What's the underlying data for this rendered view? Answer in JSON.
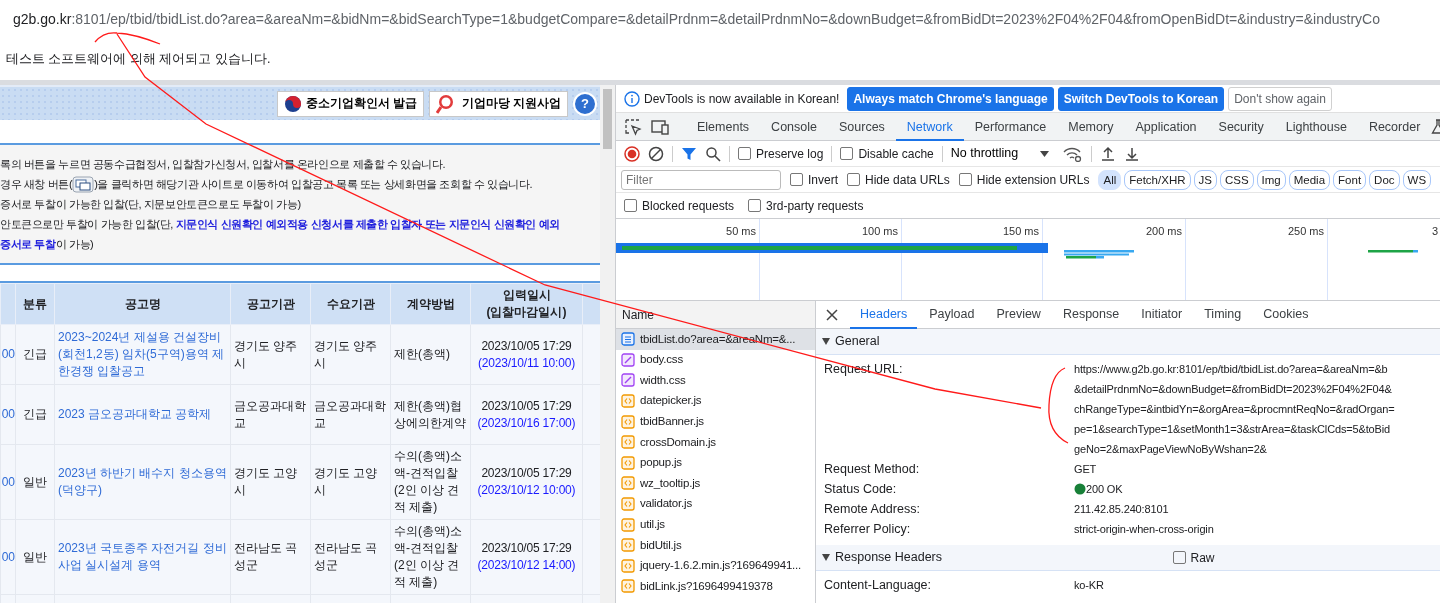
{
  "browser": {
    "url_host": "g2b.go.kr",
    "url_rest": ":8101/ep/tbid/tbidList.do?area=&areaNm=&bidNm=&bidSearchType=1&budgetCompare=&detailPrdnm=&detailPrdnmNo=&downBudget=&fromBidDt=2023%2F04%2F04&fromOpenBidDt=&industry=&industryCo",
    "infobar": "테스트 소프트웨어에 의해 제어되고 있습니다."
  },
  "page": {
    "banner_buttons": [
      {
        "label": "중소기업확인서 발급",
        "kind": "emblem"
      },
      {
        "label": "기업마당 지원사업",
        "kind": "bizinfo"
      }
    ],
    "help_label": "?",
    "notice": [
      {
        "text": "록의 버튼을 누르면 공동수급협정서, 입찰참가신청서, 입찰서를 온라인으로 제출할 수 있습니다."
      },
      {
        "text": "경우 새창 버튼(",
        "text_after": ")을 클릭하면 해당기관 사이트로 이동하여 입찰공고 목록 또는 상세화면을 조회할 수 있습니다."
      },
      {
        "text": "증서로 투찰이 가능한 입찰(단, 지문보안토큰으로도 투찰이 가능)"
      },
      {
        "text": "안토큰으로만 투찰이 가능한 입찰(단, **지문인식 신원확인 예외적용 신청서를 제출한 입찰자 또는 지문인식 신원확인 예외**"
      },
      {
        "text": "**증서로 투찰**이 가능)"
      }
    ],
    "table": {
      "columns": [
        "분류",
        "공고명",
        "공고기관",
        "수요기관",
        "계약방법",
        "입력일시\n(입찰마감일시)"
      ],
      "rows": [
        {
          "number": "00",
          "category": "긴급",
          "title": "2023~2024년 제설용 건설장비(회천1,2동) 임차(5구역)용역 제한경쟁 입찰공고",
          "agency": "경기도 양주시",
          "demand": "경기도 양주시",
          "method": "제한(총액)",
          "entered": "2023/10/05 17:29",
          "deadline": "(2023/10/11 10:00)"
        },
        {
          "number": "00",
          "category": "긴급",
          "title": "2023 금오공과대학교 공학제",
          "agency": "금오공과대학교",
          "demand": "금오공과대학교",
          "method": "제한(총액)협상에의한계약",
          "entered": "2023/10/05 17:29",
          "deadline": "(2023/10/16 17:00)"
        },
        {
          "number": "00",
          "category": "일반",
          "title": "2023년 하반기 배수지 청소용역(덕양구)",
          "agency": "경기도 고양시",
          "demand": "경기도 고양시",
          "method": "수의(총액)소액-견적입찰(2인 이상 견적 제출)",
          "entered": "2023/10/05 17:29",
          "deadline": "(2023/10/12 10:00)"
        },
        {
          "number": "00",
          "category": "일반",
          "title": "2023년 국토종주 자전거길 정비사업 실시설계 용역",
          "agency": "전라남도 곡성군",
          "demand": "전라남도 곡성군",
          "method": "수의(총액)소액-견적입찰(2인 이상 견적 제출)",
          "entered": "2023/10/05 17:29",
          "deadline": "(2023/10/12 14:00)"
        }
      ]
    }
  },
  "devtools": {
    "banner": {
      "message": "DevTools is now available in Korean!",
      "buttons": [
        {
          "label": "Always match Chrome's language",
          "kind": "primary"
        },
        {
          "label": "Switch DevTools to Korean",
          "kind": "primary"
        },
        {
          "label": "Don't show again",
          "kind": "plain"
        }
      ]
    },
    "tabs": [
      {
        "label": "Elements",
        "selected": false
      },
      {
        "label": "Console",
        "selected": false
      },
      {
        "label": "Sources",
        "selected": false
      },
      {
        "label": "Network",
        "selected": true
      },
      {
        "label": "Performance",
        "selected": false
      },
      {
        "label": "Memory",
        "selected": false
      },
      {
        "label": "Application",
        "selected": false
      },
      {
        "label": "Security",
        "selected": false
      },
      {
        "label": "Lighthouse",
        "selected": false
      },
      {
        "label": "Recorder",
        "selected": false
      }
    ],
    "toolbar": {
      "checkboxes": [
        {
          "label": "Preserve log",
          "checked": false
        },
        {
          "label": "Disable cache",
          "checked": false
        }
      ],
      "throttling": "No throttling"
    },
    "filter": {
      "placeholder": "Filter",
      "checkboxes": [
        {
          "label": "Invert",
          "checked": false
        },
        {
          "label": "Hide data URLs",
          "checked": false
        },
        {
          "label": "Hide extension URLs",
          "checked": false
        }
      ],
      "types": [
        {
          "label": "All",
          "selected": true
        },
        {
          "label": "Fetch/XHR",
          "selected": false
        },
        {
          "label": "JS",
          "selected": false
        },
        {
          "label": "CSS",
          "selected": false
        },
        {
          "label": "Img",
          "selected": false
        },
        {
          "label": "Media",
          "selected": false
        },
        {
          "label": "Font",
          "selected": false
        },
        {
          "label": "Doc",
          "selected": false
        },
        {
          "label": "WS",
          "selected": false
        }
      ],
      "more_checkboxes": [
        {
          "label": "Blocked requests",
          "checked": false
        },
        {
          "label": "3rd-party requests",
          "checked": false
        }
      ]
    },
    "overview_ticks": [
      "50 ms",
      "100 ms",
      "150 ms",
      "200 ms",
      "250 ms",
      "3"
    ],
    "requests": {
      "header": "Name",
      "items": [
        {
          "name": "tbidList.do?area=&areaNm=&...",
          "kind": "doc",
          "selected": true
        },
        {
          "name": "body.css",
          "kind": "css",
          "selected": false
        },
        {
          "name": "width.css",
          "kind": "css",
          "selected": false
        },
        {
          "name": "datepicker.js",
          "kind": "js",
          "selected": false
        },
        {
          "name": "tbidBanner.js",
          "kind": "js",
          "selected": false
        },
        {
          "name": "crossDomain.js",
          "kind": "js",
          "selected": false
        },
        {
          "name": "popup.js",
          "kind": "js",
          "selected": false
        },
        {
          "name": "wz_tooltip.js",
          "kind": "js",
          "selected": false
        },
        {
          "name": "validator.js",
          "kind": "js",
          "selected": false
        },
        {
          "name": "util.js",
          "kind": "js",
          "selected": false
        },
        {
          "name": "bidUtil.js",
          "kind": "js",
          "selected": false
        },
        {
          "name": "jquery-1.6.2.min.js?169649941...",
          "kind": "js",
          "selected": false
        },
        {
          "name": "bidLink.js?1696499419378",
          "kind": "js",
          "selected": false
        }
      ]
    },
    "detail_tabs": [
      {
        "label": "Headers",
        "selected": true
      },
      {
        "label": "Payload",
        "selected": false
      },
      {
        "label": "Preview",
        "selected": false
      },
      {
        "label": "Response",
        "selected": false
      },
      {
        "label": "Initiator",
        "selected": false
      },
      {
        "label": "Timing",
        "selected": false
      },
      {
        "label": "Cookies",
        "selected": false
      }
    ],
    "general": {
      "title": "General",
      "rows": [
        {
          "label": "Request URL:",
          "lines": [
            "https://www.g2b.go.kr:8101/ep/tbid/tbidList.do?area=&areaNm=&b",
            "&detailPrdnmNo=&downBudget=&fromBidDt=2023%2F04%2F04&",
            "chRangeType=&intbidYn=&orgArea=&procmntReqNo=&radOrgan=",
            "pe=1&searchType=1&setMonth1=3&strArea=&taskClCds=5&toBid",
            "geNo=2&maxPageViewNoByWshan=2&"
          ]
        },
        {
          "label": "Request Method:",
          "lines": [
            "GET"
          ]
        },
        {
          "label": "Status Code:",
          "lines": [
            "200 OK"
          ],
          "kind": "status"
        },
        {
          "label": "Remote Address:",
          "lines": [
            "211.42.85.240:8101"
          ]
        },
        {
          "label": "Referrer Policy:",
          "lines": [
            "strict-origin-when-cross-origin"
          ]
        }
      ]
    },
    "response_headers": {
      "title": "Response Headers",
      "raw": {
        "label": "Raw",
        "checked": false
      },
      "rows": [
        {
          "label": "Content-Language:",
          "lines": [
            "ko-KR"
          ]
        }
      ]
    }
  }
}
